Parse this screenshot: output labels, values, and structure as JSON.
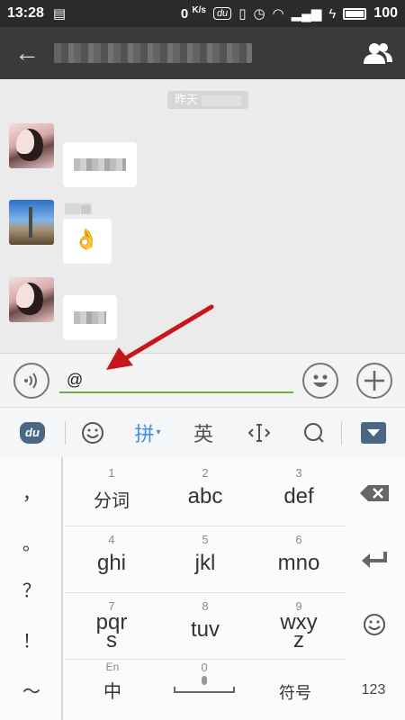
{
  "status_bar": {
    "time": "13:28",
    "net_speed_value": "0",
    "net_speed_unit": "K/s",
    "du_label": "du",
    "battery_level": "100"
  },
  "chat": {
    "timestamp": "昨天",
    "messages": [
      {
        "sender": "girl",
        "type": "text"
      },
      {
        "sender": "city",
        "type": "emoji",
        "name_fragment": "静",
        "emoji": "👌"
      },
      {
        "sender": "girl",
        "type": "text"
      }
    ]
  },
  "input": {
    "value": "@"
  },
  "keyboard_toolbar": {
    "logo_text": "du",
    "pinyin_label": "拼",
    "english_label": "英",
    "cursor_icon": "text-cursor-icon",
    "search_icon": "search-icon",
    "emoji_icon": "emoji-icon"
  },
  "keyboard": {
    "left_column": [
      "，",
      "。",
      "？",
      "！",
      "～"
    ],
    "keys": [
      {
        "num": "1",
        "label": "分词"
      },
      {
        "num": "2",
        "label": "abc"
      },
      {
        "num": "3",
        "label": "def"
      },
      {
        "num": "4",
        "label": "ghi"
      },
      {
        "num": "5",
        "label": "jkl"
      },
      {
        "num": "6",
        "label": "mno"
      },
      {
        "num": "7",
        "label_top": "pqr",
        "label_bottom": "s"
      },
      {
        "num": "8",
        "label": "tuv"
      },
      {
        "num": "9",
        "label_top": "wxy",
        "label_bottom": "z"
      }
    ],
    "en_hint": "En",
    "zh_label": "中",
    "zero_label": "0",
    "symbols_label": "符号",
    "numbers_label": "123"
  },
  "colors": {
    "title_bar": "#3a3a3a",
    "input_underline": "#62b049",
    "arrow": "#c8161d",
    "pinyin": "#3b8ff0"
  }
}
